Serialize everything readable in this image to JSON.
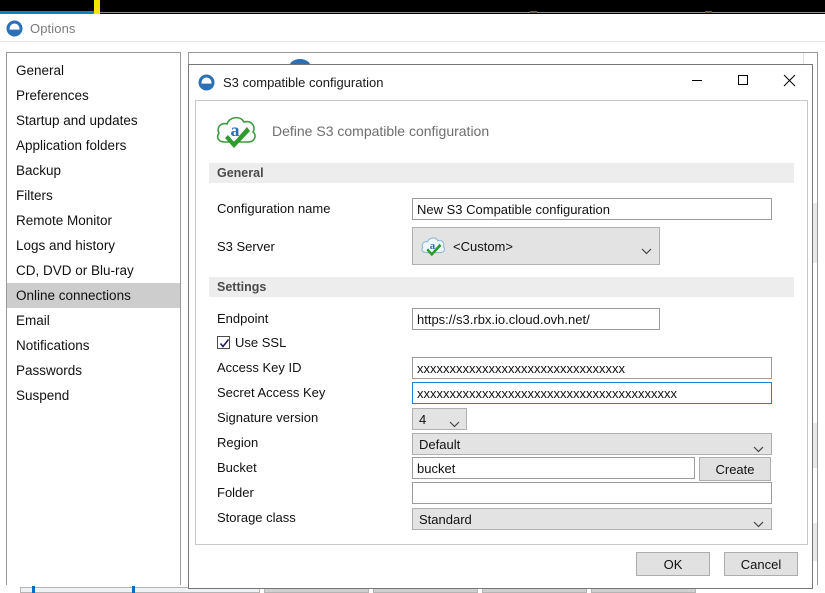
{
  "topband": {
    "progress_pct": 11,
    "marker": "yellow-position-marker"
  },
  "options_window": {
    "title": "Options",
    "logo_icon": "ashampoo-logo-icon",
    "sidebar": {
      "items": [
        {
          "label": "General",
          "selected": false
        },
        {
          "label": "Preferences",
          "selected": false
        },
        {
          "label": "Startup and updates",
          "selected": false
        },
        {
          "label": "Application folders",
          "selected": false
        },
        {
          "label": "Backup",
          "selected": false
        },
        {
          "label": "Filters",
          "selected": false
        },
        {
          "label": "Remote Monitor",
          "selected": false
        },
        {
          "label": "Logs and history",
          "selected": false
        },
        {
          "label": "CD, DVD or Blu-ray",
          "selected": false
        },
        {
          "label": "Online connections",
          "selected": true
        },
        {
          "label": "Email",
          "selected": false
        },
        {
          "label": "Notifications",
          "selected": false
        },
        {
          "label": "Passwords",
          "selected": false
        },
        {
          "label": "Suspend",
          "selected": false
        }
      ]
    }
  },
  "dialog": {
    "title": "S3 compatible configuration",
    "title_icon": "ashampoo-logo-icon",
    "window_buttons": {
      "minimize": "minimize-icon",
      "maximize": "maximize-icon",
      "close": "close-icon"
    },
    "header": {
      "icon": "s3-cloud-icon",
      "text": "Define S3 compatible configuration"
    },
    "sections": {
      "general": {
        "title": "General",
        "fields": {
          "configuration_name": {
            "label": "Configuration name",
            "value": "New S3 Compatible configuration",
            "placeholder": ""
          },
          "s3_server": {
            "label": "S3 Server",
            "value": "<Custom>",
            "icon": "s3-cloud-icon",
            "chevron": "chevron-down-icon"
          }
        }
      },
      "settings": {
        "title": "Settings",
        "fields": {
          "endpoint": {
            "label": "Endpoint",
            "value": "https://s3.rbx.io.cloud.ovh.net/",
            "placeholder": ""
          },
          "use_ssl": {
            "label": "Use SSL",
            "checked": true,
            "check_icon": "checkmark-icon"
          },
          "access_key_id": {
            "label": "Access Key ID",
            "value": "xxxxxxxxxxxxxxxxxxxxxxxxxxxxxxxx",
            "placeholder": ""
          },
          "secret_access_key": {
            "label": "Secret Access Key",
            "value": "xxxxxxxxxxxxxxxxxxxxxxxxxxxxxxxxxxxxxxxx",
            "placeholder": "",
            "focused": true
          },
          "signature_version": {
            "label": "Signature version",
            "value": "4",
            "chevron": "chevron-down-icon"
          },
          "region": {
            "label": "Region",
            "value": "Default",
            "chevron": "chevron-down-icon"
          },
          "bucket": {
            "label": "Bucket",
            "value": "bucket",
            "placeholder": "",
            "create_button": "Create"
          },
          "folder": {
            "label": "Folder",
            "value": "",
            "placeholder": ""
          },
          "storage_class": {
            "label": "Storage class",
            "value": "Standard",
            "chevron": "chevron-down-icon"
          }
        }
      }
    },
    "footer": {
      "ok_label": "OK",
      "cancel_label": "Cancel"
    }
  },
  "colors": {
    "accent_blue": "#0a84c1",
    "marker_yellow": "#f2e500",
    "selection_gray": "#cdcdcd",
    "section_bar": "#ededed",
    "focus_border": "#2c7fd0",
    "logo_blue": "#2b6fb5",
    "check_green": "#3e9b3e"
  }
}
